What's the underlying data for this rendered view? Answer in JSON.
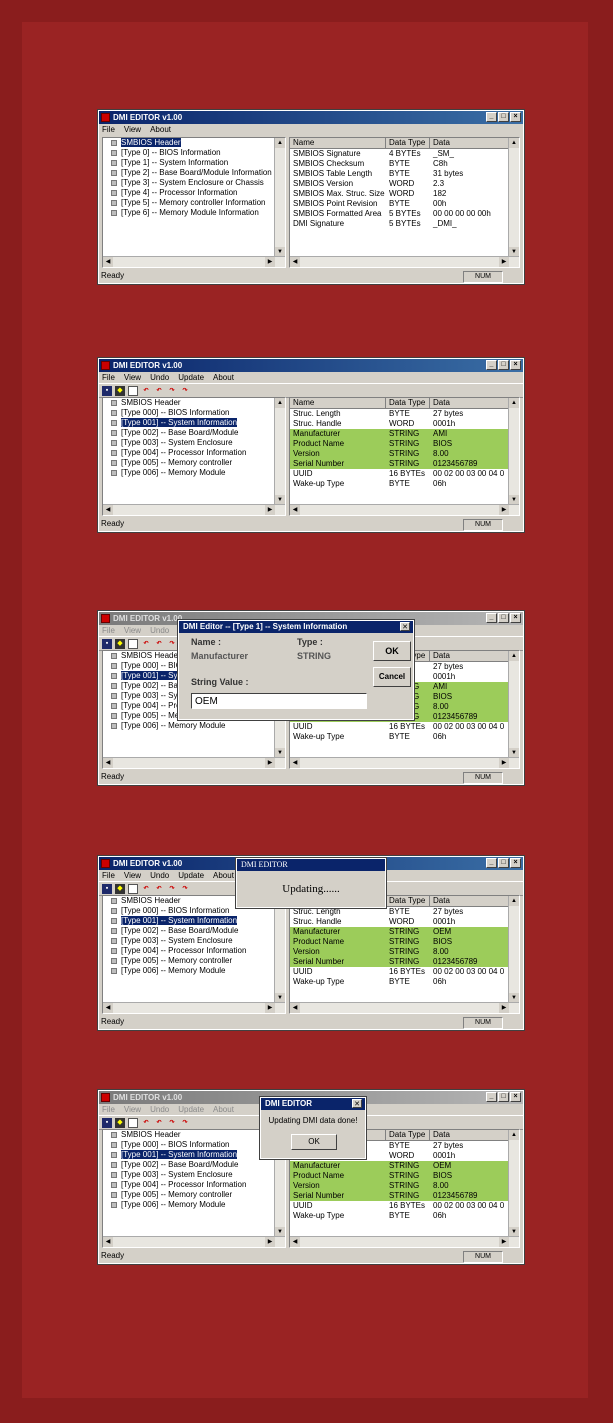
{
  "windows": [
    {
      "title": "DMI EDITOR v1.00",
      "menu": [
        "File",
        "View",
        "About"
      ],
      "toolbar": false,
      "tree": [
        "SMBIOS Header",
        "[Type  0] -- BIOS Information",
        "[Type  1] -- System Information",
        "[Type  2] -- Base Board/Module Information",
        "[Type  3] -- System Enclosure or Chassis",
        "[Type  4] -- Processor Information",
        "[Type  5] -- Memory controller Information",
        "[Type  6] -- Memory Module Information"
      ],
      "selected": 0,
      "headers": [
        "Name",
        "Data Type",
        "Data"
      ],
      "rows": [
        [
          "SMBIOS Signature",
          "4 BYTEs",
          "_SM_"
        ],
        [
          "SMBIOS Checksum",
          "BYTE",
          "C8h"
        ],
        [
          "SMBIOS Table Length",
          "BYTE",
          "31 bytes"
        ],
        [
          "SMBIOS Version",
          "WORD",
          "2.3"
        ],
        [
          "SMBIOS Max. Struc. Size",
          "WORD",
          "182"
        ],
        [
          "SMBIOS Point Revision",
          "BYTE",
          "00h"
        ],
        [
          "SMBIOS Formatted Area",
          "5 BYTEs",
          "00 00 00 00 00h"
        ],
        [
          "DMI Signature",
          "5 BYTEs",
          "_DMI_"
        ]
      ],
      "highlight": [],
      "status": "Ready",
      "num": "NUM"
    },
    {
      "title": "DMI EDITOR v1.00",
      "menu": [
        "File",
        "View",
        "Undo",
        "Update",
        "About"
      ],
      "toolbar": true,
      "tree": [
        "SMBIOS Header",
        "[Type 000] -- BIOS Information",
        "[Type 001] -- System Information",
        "[Type 002] -- Base Board/Module",
        "[Type 003] -- System Enclosure",
        "[Type 004] -- Processor Information",
        "[Type 005] -- Memory controller",
        "[Type 006] -- Memory Module"
      ],
      "selected": 2,
      "headers": [
        "Name",
        "Data Type",
        "Data"
      ],
      "rows": [
        [
          "Struc. Length",
          "BYTE",
          "27 bytes"
        ],
        [
          "Struc. Handle",
          "WORD",
          "0001h"
        ],
        [
          "Manufacturer",
          "STRING",
          "AMI"
        ],
        [
          "Product Name",
          "STRING",
          "BIOS"
        ],
        [
          "Version",
          "STRING",
          "8.00"
        ],
        [
          "Serial Number",
          "STRING",
          "0123456789"
        ],
        [
          "UUID",
          "16 BYTEs",
          "00 02 00 03 00 04 0"
        ],
        [
          "Wake-up Type",
          "BYTE",
          "06h"
        ]
      ],
      "highlight": [
        2,
        3,
        4,
        5
      ],
      "status": "Ready",
      "num": "NUM"
    },
    {
      "title": "DMI EDITOR v1.00",
      "menu": [
        "File",
        "View",
        "Undo",
        "Update",
        "About"
      ],
      "toolbar": true,
      "tree": [
        "SMBIOS Header",
        "[Type 000] -- BIOS Information",
        "[Type 001] -- System Information",
        "[Type 002] -- Base Board/Module",
        "[Type 003] -- System Enclosure",
        "[Type 004] -- Processor Information",
        "[Type 005] -- Memory controller",
        "[Type 006] -- Memory Module"
      ],
      "selected": 2,
      "headers": [
        "Name",
        "Data Type",
        "Data"
      ],
      "rows": [
        [
          "Struc. Length",
          "BYTE",
          "27 bytes"
        ],
        [
          "Struc. Handle",
          "WORD",
          "0001h"
        ],
        [
          "Manufacturer",
          "STRING",
          "AMI"
        ],
        [
          "Product Name",
          "STRING",
          "BIOS"
        ],
        [
          "Version",
          "STRING",
          "8.00"
        ],
        [
          "Serial Number",
          "STRING",
          "0123456789"
        ],
        [
          "UUID",
          "16 BYTEs",
          "00 02 00 03 00 04 0"
        ],
        [
          "Wake-up Type",
          "BYTE",
          "06h"
        ]
      ],
      "highlight": [
        2,
        3,
        4,
        5
      ],
      "status": "Ready",
      "num": "NUM"
    },
    {
      "title": "DMI EDITOR v1.00",
      "menu": [
        "File",
        "View",
        "Undo",
        "Update",
        "About"
      ],
      "toolbar": true,
      "tree": [
        "SMBIOS Header",
        "[Type 000] -- BIOS Information",
        "[Type 001] -- System Information",
        "[Type 002] -- Base Board/Module",
        "[Type 003] -- System Enclosure",
        "[Type 004] -- Processor Information",
        "[Type 005] -- Memory controller",
        "[Type 006] -- Memory Module"
      ],
      "selected": 2,
      "headers": [
        "Name",
        "Data Type",
        "Data"
      ],
      "rows": [
        [
          "Struc. Length",
          "BYTE",
          "27 bytes"
        ],
        [
          "Struc. Handle",
          "WORD",
          "0001h"
        ],
        [
          "Manufacturer",
          "STRING",
          "OEM"
        ],
        [
          "Product Name",
          "STRING",
          "BIOS"
        ],
        [
          "Version",
          "STRING",
          "8.00"
        ],
        [
          "Serial Number",
          "STRING",
          "0123456789"
        ],
        [
          "UUID",
          "16 BYTEs",
          "00 02 00 03 00 04 0"
        ],
        [
          "Wake-up Type",
          "BYTE",
          "06h"
        ]
      ],
      "highlight": [
        2,
        3,
        4,
        5
      ],
      "status": "Ready",
      "num": "NUM"
    },
    {
      "title": "DMI EDITOR v1.00",
      "menu": [
        "File",
        "View",
        "Undo",
        "Update",
        "About"
      ],
      "toolbar": true,
      "tree": [
        "SMBIOS Header",
        "[Type 000] -- BIOS Information",
        "[Type 001] -- System Information",
        "[Type 002] -- Base Board/Module",
        "[Type 003] -- System Enclosure",
        "[Type 004] -- Processor Information",
        "[Type 005] -- Memory controller",
        "[Type 006] -- Memory Module"
      ],
      "selected": 2,
      "headers": [
        "Name",
        "Data Type",
        "Data"
      ],
      "rows": [
        [
          "Struc. Length",
          "BYTE",
          "27 bytes"
        ],
        [
          "Struc. Handle",
          "WORD",
          "0001h"
        ],
        [
          "Manufacturer",
          "STRING",
          "OEM"
        ],
        [
          "Product Name",
          "STRING",
          "BIOS"
        ],
        [
          "Version",
          "STRING",
          "8.00"
        ],
        [
          "Serial Number",
          "STRING",
          "0123456789"
        ],
        [
          "UUID",
          "16 BYTEs",
          "00 02 00 03 00 04 0"
        ],
        [
          "Wake-up Type",
          "BYTE",
          "06h"
        ]
      ],
      "highlight": [
        2,
        3,
        4,
        5
      ],
      "status": "Ready",
      "num": "NUM"
    }
  ],
  "edit_dialog": {
    "title": "DMI Editor -- [Type  1] -- System Information",
    "name_label": "Name :",
    "type_label": "Type :",
    "name_value": "Manufacturer",
    "type_value": "STRING",
    "string_label": "String Value :",
    "input_value": "OEM",
    "ok": "OK",
    "cancel": "Cancel"
  },
  "updating_dialog": {
    "title": "DMI EDITOR",
    "message": "Updating......"
  },
  "done_dialog": {
    "title": "DMI EDITOR",
    "message": "Updating DMI data done!",
    "ok": "OK"
  },
  "colors": {
    "background": "#8a1d1d",
    "title_active": "#0a246a",
    "highlight_row": "#9ccc5a"
  }
}
